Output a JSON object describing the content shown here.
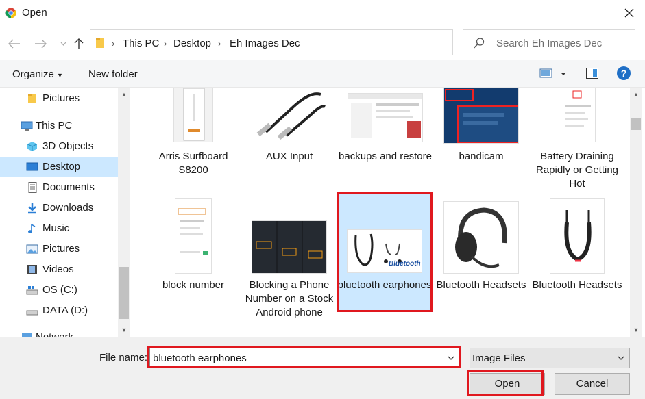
{
  "window": {
    "title": "Open",
    "close_icon": "close-icon",
    "app_icon": "chrome-icon"
  },
  "nav": {
    "back_icon": "back-arrow-icon",
    "forward_icon": "forward-arrow-icon",
    "up_icon": "up-arrow-icon"
  },
  "address": {
    "crumbs": [
      "This PC",
      "Desktop",
      "Eh Images Dec"
    ],
    "refresh_icon": "refresh-icon"
  },
  "search": {
    "placeholder": "Search Eh Images Dec"
  },
  "toolbar": {
    "organize_label": "Organize",
    "new_folder_label": "New folder"
  },
  "sidebar": {
    "items": [
      {
        "label": "Pictures",
        "icon": "folder-icon"
      },
      {
        "label": "This PC",
        "icon": "computer-icon"
      },
      {
        "label": "3D Objects",
        "icon": "3d-objects-icon"
      },
      {
        "label": "Desktop",
        "icon": "desktop-icon",
        "selected": true
      },
      {
        "label": "Documents",
        "icon": "documents-icon"
      },
      {
        "label": "Downloads",
        "icon": "downloads-icon"
      },
      {
        "label": "Music",
        "icon": "music-icon"
      },
      {
        "label": "Pictures",
        "icon": "pictures-icon"
      },
      {
        "label": "Videos",
        "icon": "videos-icon"
      },
      {
        "label": "OS (C:)",
        "icon": "drive-icon"
      },
      {
        "label": "DATA (D:)",
        "icon": "drive-icon"
      },
      {
        "label": "Network",
        "icon": "network-icon"
      }
    ]
  },
  "files": [
    {
      "label": "Arris Surfboard S8200"
    },
    {
      "label": "AUX Input"
    },
    {
      "label": "backups and restore"
    },
    {
      "label": "bandicam"
    },
    {
      "label": "Battery Draining Rapidly or Getting Hot"
    },
    {
      "label": "block number"
    },
    {
      "label": "Blocking a Phone Number on a Stock Android phone"
    },
    {
      "label": "bluetooth earphones",
      "selected": true,
      "thumb_text": "Bluetooth"
    },
    {
      "label": "Bluetooth Headsets"
    },
    {
      "label": "Bluetooth Headsets"
    }
  ],
  "footer": {
    "file_name_label": "File name:",
    "file_name_value": "bluetooth earphones",
    "filter_value": "Image Files",
    "open_label": "Open",
    "cancel_label": "Cancel"
  },
  "colors": {
    "highlight": "#e0181f",
    "selection": "#cce8ff",
    "accent": "#0078d7"
  }
}
